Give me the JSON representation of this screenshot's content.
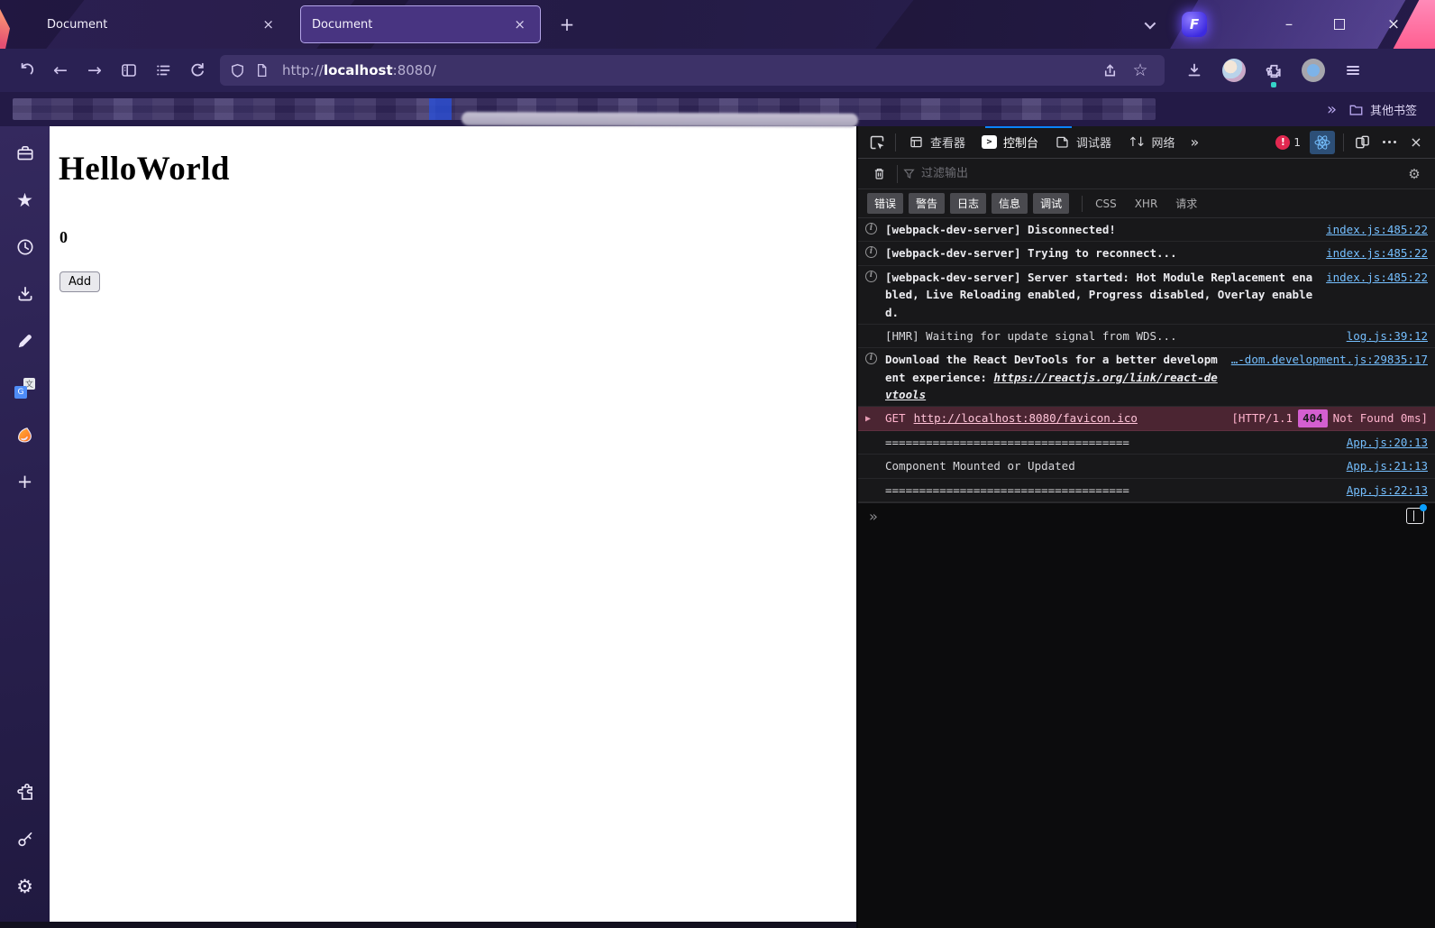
{
  "glyphs": {
    "close": "×",
    "plus": "+",
    "minimize": "–",
    "overflow": "»",
    "prompt": "»",
    "back": "←",
    "forward": "→",
    "star": "★",
    "star_outline": "☆",
    "gear": "⚙",
    "network": "↑↓",
    "info": "i",
    "bang": "!",
    "caret": "▶",
    "console_caret": ">",
    "translate_back": "文",
    "translate_front": "G",
    "logo_letter": "F"
  },
  "titlebar": {
    "tabs": [
      {
        "title": "Document"
      },
      {
        "title": "Document"
      }
    ]
  },
  "toolbar": {
    "url": {
      "scheme": "http://",
      "host": "localhost",
      "rest": ":8080/"
    }
  },
  "bookmarks": {
    "other_label": "其他书签"
  },
  "page": {
    "heading": "HelloWorld",
    "count": "0",
    "add_button": "Add"
  },
  "devtools": {
    "tabs": {
      "inspector": "查看器",
      "console": "控制台",
      "debugger": "调试器",
      "network": "网络"
    },
    "error_count": "1",
    "filter": {
      "placeholder": "过滤输出",
      "buttons": [
        "错误",
        "警告",
        "日志",
        "信息",
        "调试"
      ],
      "plain": [
        "CSS",
        "XHR",
        "请求"
      ]
    },
    "messages": [
      {
        "type": "info",
        "text": "[webpack-dev-server] Disconnected!",
        "source": "index.js:485:22"
      },
      {
        "type": "info",
        "text": "[webpack-dev-server] Trying to reconnect...",
        "source": "index.js:485:22"
      },
      {
        "type": "info",
        "text": "[webpack-dev-server] Server started: Hot Module Replacement enabled, Live Reloading enabled, Progress disabled, Overlay enabled.",
        "source": "index.js:485:22"
      },
      {
        "type": "log",
        "text": "[HMR] Waiting for update signal from WDS...",
        "source": "log.js:39:12"
      },
      {
        "type": "info",
        "text": "Download the React DevTools for a better development experience: ",
        "link": "https://reactjs.org/link/react-devtools",
        "source": "…-dom.development.js:29835:17"
      },
      {
        "type": "network-error",
        "method": "GET",
        "url": "http://localhost:8080/favicon.ico",
        "status_pre": "[HTTP/1.1",
        "status_code": "404",
        "status_post": "Not Found 0ms]"
      },
      {
        "type": "log",
        "text": "====================================",
        "source": "App.js:20:13"
      },
      {
        "type": "log",
        "text": "Component Mounted or Updated",
        "source": "App.js:21:13"
      },
      {
        "type": "log",
        "text": "====================================",
        "source": "App.js:22:13"
      }
    ],
    "colors": {
      "link": "#75bfff",
      "active_tab_line": "#0a84ff",
      "error_badge": "#e22850",
      "status_badge": "#d45fd0"
    }
  }
}
